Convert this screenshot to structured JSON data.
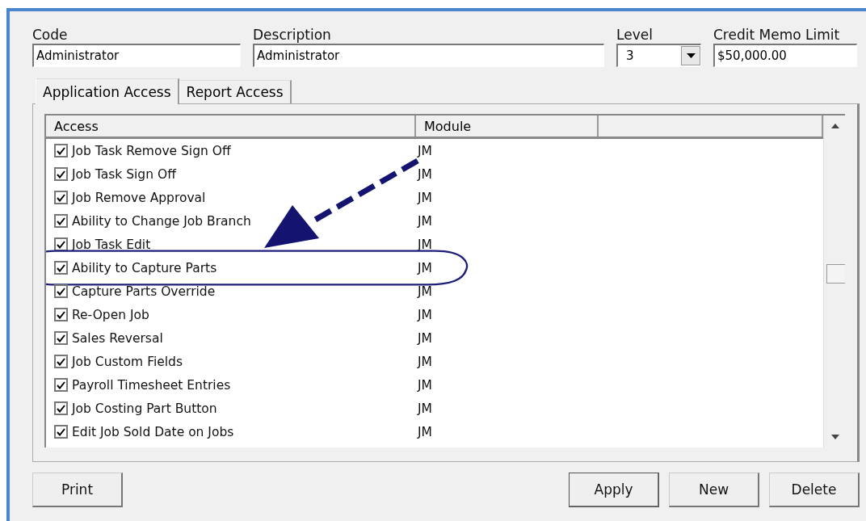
{
  "fields": [
    {
      "label": "Code",
      "value": "Administrator",
      "kind": "text"
    },
    {
      "label": "Description",
      "value": "Administrator",
      "kind": "text"
    },
    {
      "label": "Level",
      "value": "3",
      "kind": "dropdown"
    },
    {
      "label": "Credit Memo Limit",
      "value": "$50,000.00",
      "kind": "text"
    }
  ],
  "tabs": [
    {
      "label": "Application Access",
      "selected": true
    },
    {
      "label": "Report Access",
      "selected": false
    }
  ],
  "table": {
    "columns": [
      "Access",
      "Module"
    ],
    "rows": [
      {
        "access": "Job Task Remove Sign Off",
        "module": "JM",
        "checked": true,
        "highlighted": false
      },
      {
        "access": "Job Task Sign Off",
        "module": "JM",
        "checked": true,
        "highlighted": false
      },
      {
        "access": "Job Remove Approval",
        "module": "JM",
        "checked": true,
        "highlighted": false
      },
      {
        "access": "Ability to Change Job Branch",
        "module": "JM",
        "checked": true,
        "highlighted": false
      },
      {
        "access": "Job Task Edit",
        "module": "JM",
        "checked": true,
        "highlighted": false
      },
      {
        "access": "Ability to Capture Parts",
        "module": "JM",
        "checked": true,
        "highlighted": true
      },
      {
        "access": "Capture Parts Override",
        "module": "JM",
        "checked": true,
        "highlighted": false
      },
      {
        "access": "Re-Open Job",
        "module": "JM",
        "checked": true,
        "highlighted": false
      },
      {
        "access": "Sales Reversal",
        "module": "JM",
        "checked": true,
        "highlighted": false
      },
      {
        "access": "Job Custom Fields",
        "module": "JM",
        "checked": true,
        "highlighted": false
      },
      {
        "access": "Payroll Timesheet Entries",
        "module": "JM",
        "checked": true,
        "highlighted": false
      },
      {
        "access": "Job Costing Part Button",
        "module": "JM",
        "checked": true,
        "highlighted": false
      },
      {
        "access": "Edit Job Sold Date on Jobs",
        "module": "JM",
        "checked": true,
        "highlighted": false
      }
    ]
  },
  "buttons": [
    {
      "label": "Print",
      "default": false
    },
    {
      "label": "Apply",
      "default": true
    },
    {
      "label": "New",
      "default": false
    },
    {
      "label": "Delete",
      "default": false
    }
  ]
}
